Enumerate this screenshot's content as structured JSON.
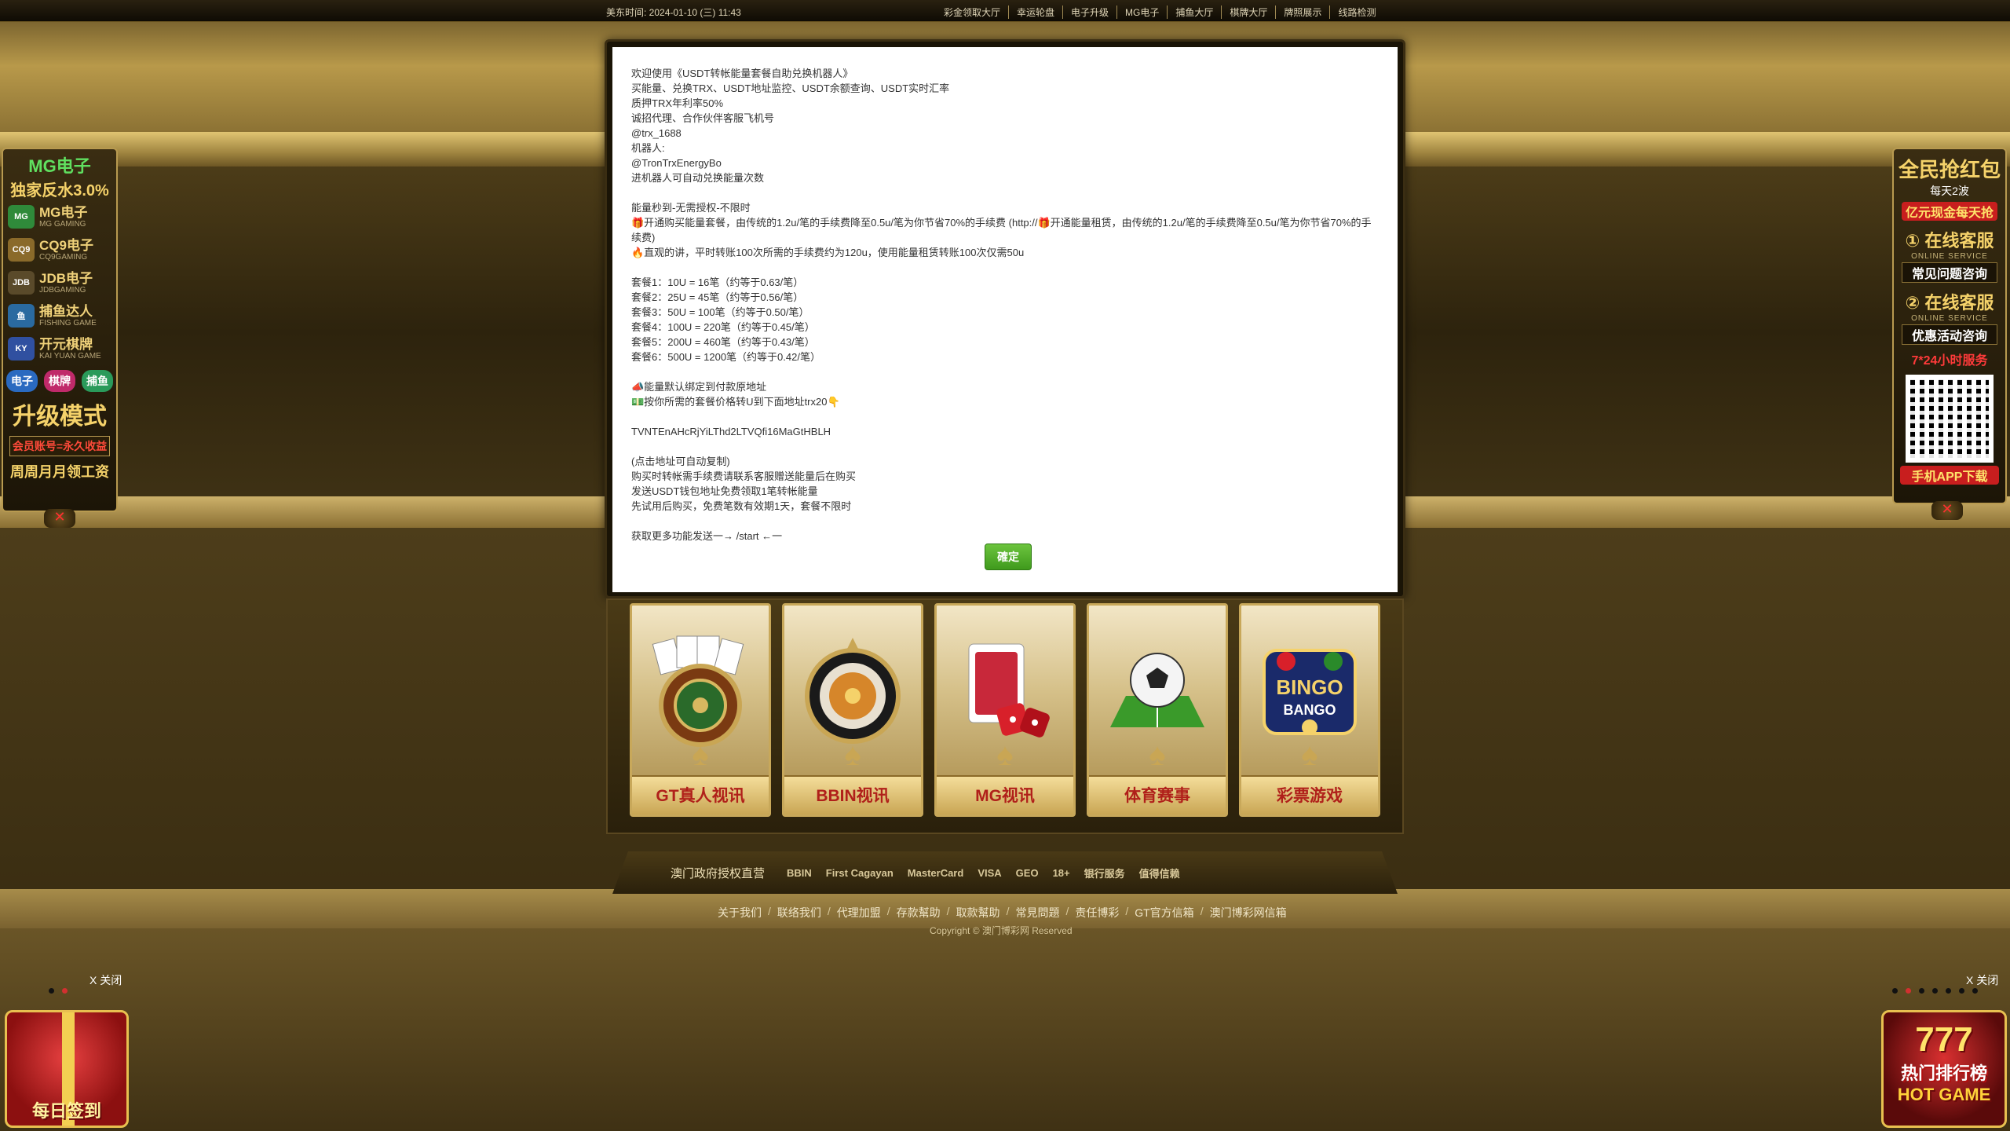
{
  "topbar": {
    "time": "美东时间: 2024-01-10 (三) 11:43",
    "nav": [
      "彩金领取大厅",
      "幸运轮盘",
      "电子升级",
      "MG电子",
      "捕鱼大厅",
      "棋牌大厅",
      "牌照展示",
      "线路检测"
    ]
  },
  "left_panel": {
    "promo_title": "MG电子",
    "promo_sub": "独家反水3.0%",
    "games": [
      {
        "name": "MG电子",
        "sub": "MG GAMING",
        "icon": "mg-icon",
        "color": "#2f8a3a",
        "abbr": "MG"
      },
      {
        "name": "CQ9电子",
        "sub": "CQ9GAMING",
        "icon": "cq9-icon",
        "color": "#8a6a2a",
        "abbr": "CQ9"
      },
      {
        "name": "JDB电子",
        "sub": "JDBGAMING",
        "icon": "jdb-icon",
        "color": "#5a4a2a",
        "abbr": "JDB"
      },
      {
        "name": "捕鱼达人",
        "sub": "FISHING GAME",
        "icon": "fish-icon",
        "color": "#2a6aa0",
        "abbr": "鱼"
      },
      {
        "name": "开元棋牌",
        "sub": "KAI YUAN GAME",
        "icon": "ky-icon",
        "color": "#3050a0",
        "abbr": "KY"
      }
    ],
    "tags": [
      "电子",
      "棋牌",
      "捕鱼"
    ],
    "upgrade": "升级模式",
    "member": "会员账号=永久收益",
    "salary": "周周月月领工资",
    "close": "✕"
  },
  "right_panel": {
    "hb_title": "全民抢红包",
    "hb_sub": "每天2波",
    "hb_prize": "亿元现金每天抢",
    "svc1_title": "① 在线客服",
    "svc1_en": "ONLINE SERVICE",
    "svc1_btn": "常见问题咨询",
    "svc2_title": "② 在线客服",
    "svc2_en": "ONLINE SERVICE",
    "svc2_btn": "优惠活动咨询",
    "hours": "7*24小时服务",
    "app_download": "手机APP下载",
    "close": "✕"
  },
  "modal": {
    "lines": [
      "欢迎使用《USDT转帐能量套餐自助兑换机器人》",
      "买能量、兑换TRX、USDT地址监控、USDT余额查询、USDT实时汇率",
      "质押TRX年利率50%",
      "诚招代理、合作伙伴客服飞机号",
      "@trx_1688",
      "机器人:",
      "@TronTrxEnergyBo",
      "进机器人可自动兑换能量次数",
      "",
      "能量秒到-无需授权-不限时",
      "🎁开通购买能量套餐，由传统的1.2u/笔的手续费降至0.5u/笔为你节省70%的手续费 (http://🎁开通能量租赁，由传统的1.2u/笔的手续费降至0.5u/笔为你节省70%的手续费)",
      "🔥直观的讲，平时转账100次所需的手续费约为120u，使用能量租赁转账100次仅需50u",
      "",
      "套餐1：10U = 16笔（约等于0.63/笔）",
      "套餐2：25U = 45笔（约等于0.56/笔）",
      "套餐3：50U = 100笔（约等于0.50/笔）",
      "套餐4：100U = 220笔（约等于0.45/笔）",
      "套餐5：200U = 460笔（约等于0.43/笔）",
      "套餐6：500U = 1200笔（约等于0.42/笔）",
      "",
      "📣能量默认绑定到付款原地址",
      "💵按你所需的套餐价格转U到下面地址trx20👇",
      "",
      "TVNTEnAHcRjYiLThd2LTVQfi16MaGtHBLH",
      "",
      "(点击地址可自动复制)",
      "购买时转帐需手续费请联系客服赠送能量后在购买",
      "发送USDT钱包地址免费领取1笔转帐能量",
      "先试用后购买，免费笔数有效期1天，套餐不限时",
      "",
      "获取更多功能发送一→ /start ←一"
    ],
    "ok_label": "確定"
  },
  "games": [
    {
      "label": "GT真人视讯",
      "art": "roulette-cards-icon"
    },
    {
      "label": "BBIN视讯",
      "art": "roulette-wheel-icon"
    },
    {
      "label": "MG视讯",
      "art": "cards-dice-icon"
    },
    {
      "label": "体育赛事",
      "art": "soccer-ball-icon"
    },
    {
      "label": "彩票游戏",
      "art": "bingo-icon"
    }
  ],
  "footer": {
    "license": "澳门政府授权直营",
    "logos": [
      "BBIN",
      "First Cagayan",
      "MasterCard",
      "VISA",
      "GEO",
      "18+",
      "银行服务",
      "值得信赖"
    ],
    "links": [
      "关于我们",
      "联络我们",
      "代理加盟",
      "存款幫助",
      "取款幫助",
      "常見問題",
      "责任博彩",
      "GT官方信箱",
      "澳门博彩网信箱"
    ],
    "copyright": "Copyright © 澳门博彩网 Reserved"
  },
  "bottom_left": {
    "close": "X 关闭",
    "gift_text": "每日签到"
  },
  "bottom_right": {
    "close": "X 关闭",
    "sevens": "777",
    "hot_text": "热门排行榜",
    "hot_sub": "HOT GAME"
  },
  "colors": {
    "accent_gold": "#c9a654",
    "ok_green": "#4fae28",
    "alert_red": "#c81e1e"
  }
}
